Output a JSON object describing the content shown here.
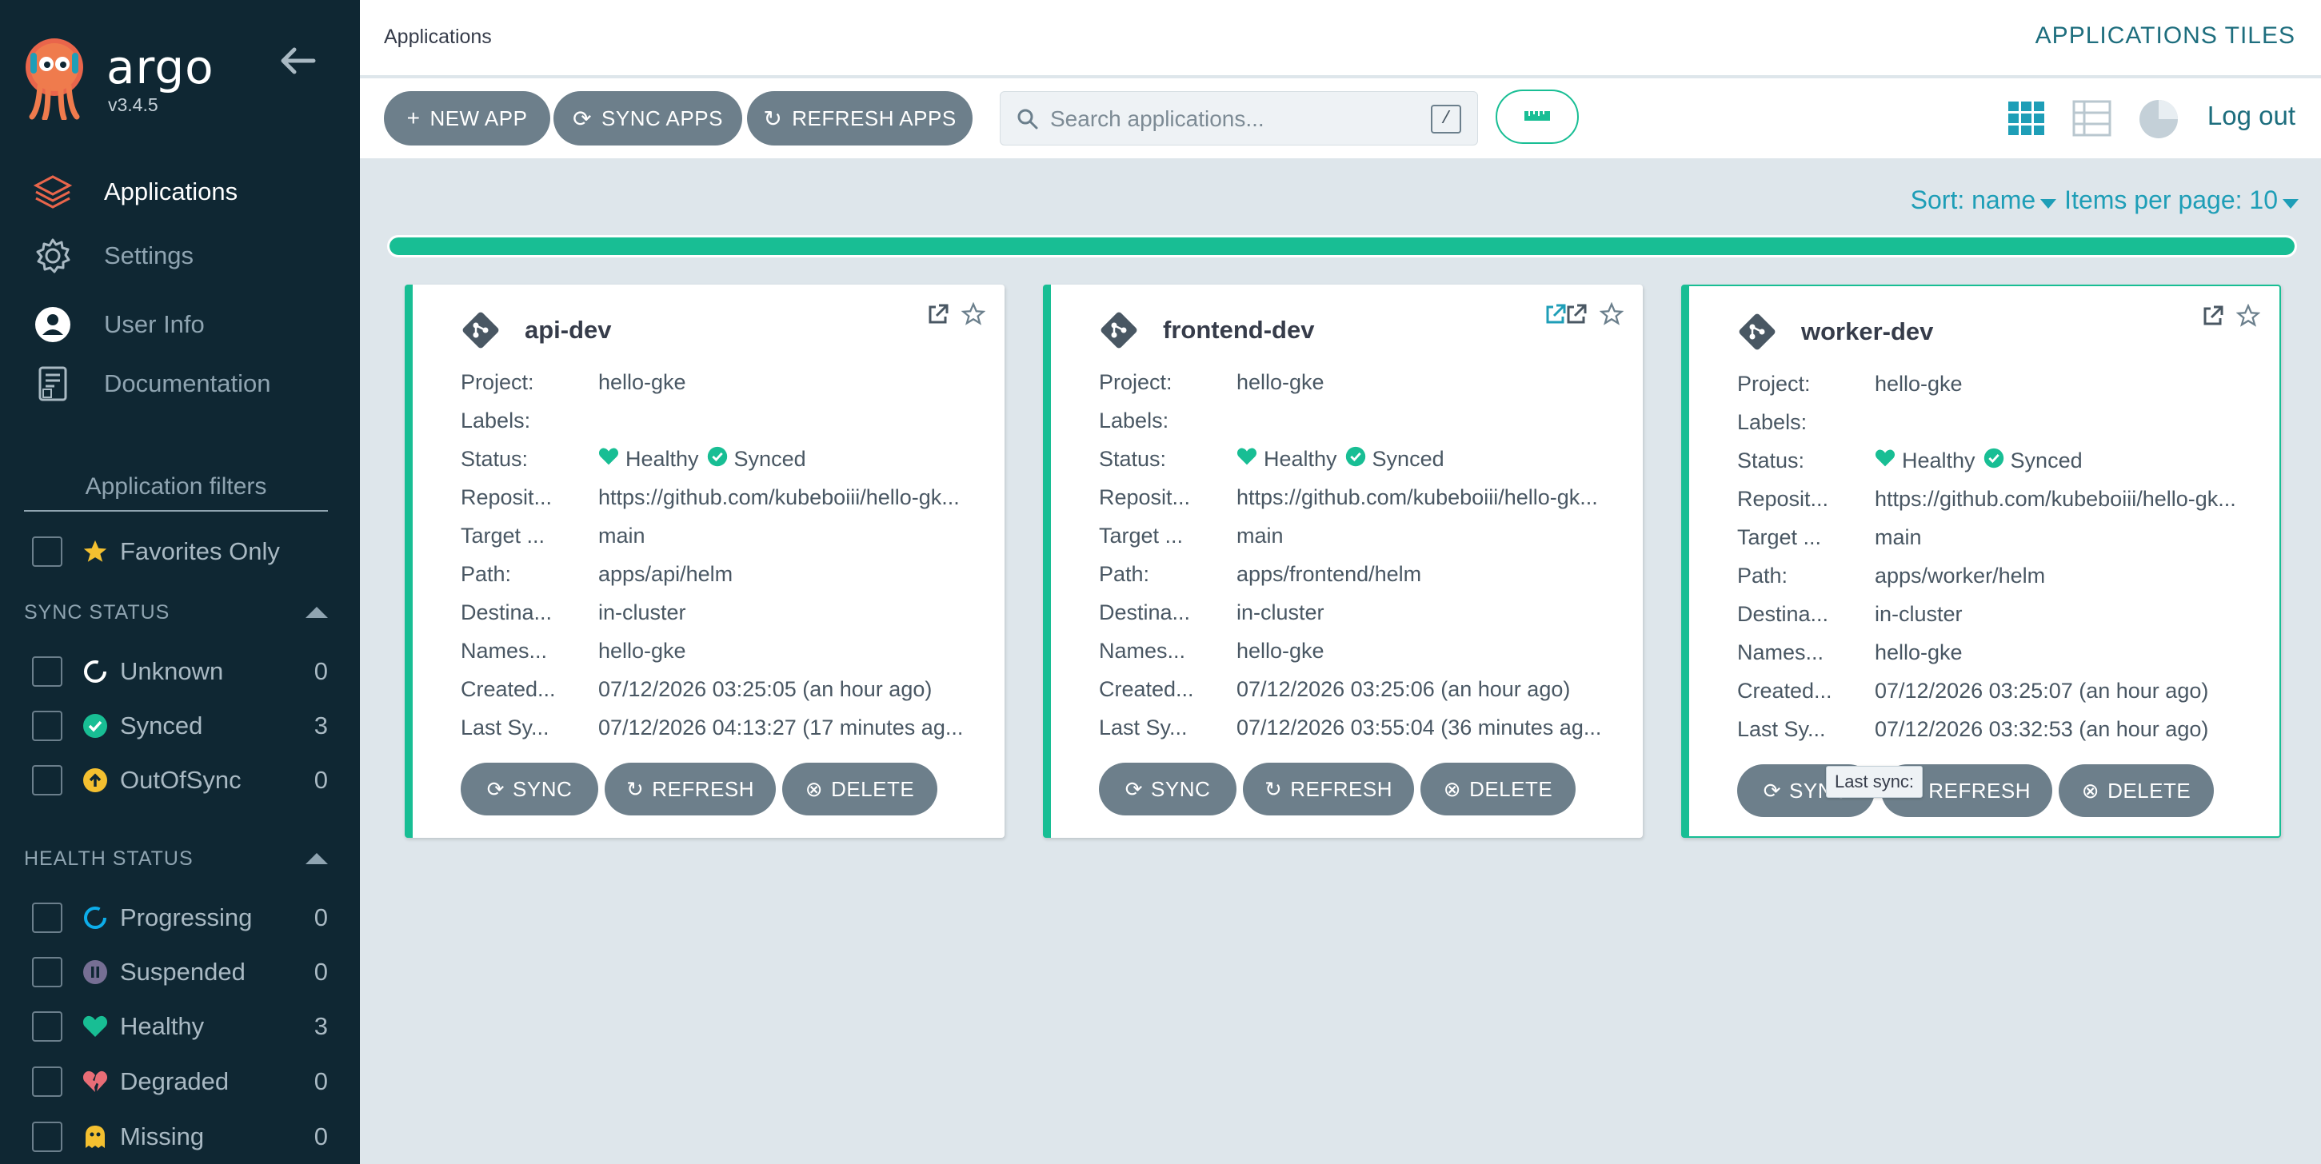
{
  "sidebar": {
    "brand": "argo",
    "version": "v3.4.5",
    "nav": [
      {
        "label": "Applications",
        "icon": "layers-icon",
        "active": true
      },
      {
        "label": "Settings",
        "icon": "gear-icon"
      },
      {
        "label": "User Info",
        "icon": "user-icon"
      },
      {
        "label": "Documentation",
        "icon": "docs-icon"
      }
    ],
    "filters_title": "Application filters",
    "favorites_label": "Favorites Only",
    "sync_status_title": "SYNC STATUS",
    "sync_status": [
      {
        "label": "Unknown",
        "count": "0"
      },
      {
        "label": "Synced",
        "count": "3"
      },
      {
        "label": "OutOfSync",
        "count": "0"
      }
    ],
    "health_status_title": "HEALTH STATUS",
    "health_status": [
      {
        "label": "Progressing",
        "count": "0"
      },
      {
        "label": "Suspended",
        "count": "0"
      },
      {
        "label": "Healthy",
        "count": "3"
      },
      {
        "label": "Degraded",
        "count": "0"
      },
      {
        "label": "Missing",
        "count": "0"
      }
    ]
  },
  "topbar": {
    "breadcrumb": "Applications",
    "view_title": "APPLICATIONS TILES"
  },
  "toolbar": {
    "new_app": "NEW APP",
    "sync_apps": "SYNC APPS",
    "refresh_apps": "REFRESH APPS",
    "search_placeholder": "Search applications...",
    "search_shortcut": "/",
    "logout": "Log out"
  },
  "sort": {
    "sort_label": "Sort: name",
    "items_label": "Items per page: 10"
  },
  "progress": {
    "fraction": 1.0
  },
  "colors": {
    "accent": "#18be94",
    "sidebar_bg": "#0f2733",
    "button_bg": "#6d7f8b",
    "link": "#1e9eb7"
  },
  "field_labels": {
    "project": "Project:",
    "labels": "Labels:",
    "status": "Status:",
    "repository": "Reposit...",
    "target": "Target ...",
    "path": "Path:",
    "destination": "Destina...",
    "namespace": "Names...",
    "created": "Created...",
    "last_sync": "Last Sy..."
  },
  "card_buttons": {
    "sync": "SYNC",
    "refresh": "REFRESH",
    "delete": "DELETE"
  },
  "apps": [
    {
      "name": "api-dev",
      "project": "hello-gke",
      "labels": "",
      "health": "Healthy",
      "sync": "Synced",
      "repository": "https://github.com/kubeboiii/hello-gk...",
      "target": "main",
      "path": "apps/api/helm",
      "destination": "in-cluster",
      "namespace": "hello-gke",
      "created": "07/12/2026 03:25:05  (an hour ago)",
      "last_sync": "07/12/2026 04:13:27  (17 minutes ag..."
    },
    {
      "name": "frontend-dev",
      "project": "hello-gke",
      "labels": "",
      "health": "Healthy",
      "sync": "Synced",
      "repository": "https://github.com/kubeboiii/hello-gk...",
      "target": "main",
      "path": "apps/frontend/helm",
      "destination": "in-cluster",
      "namespace": "hello-gke",
      "created": "07/12/2026 03:25:06  (an hour ago)",
      "last_sync": "07/12/2026 03:55:04  (36 minutes ag..."
    },
    {
      "name": "worker-dev",
      "project": "hello-gke",
      "labels": "",
      "health": "Healthy",
      "sync": "Synced",
      "repository": "https://github.com/kubeboiii/hello-gk...",
      "target": "main",
      "path": "apps/worker/helm",
      "destination": "in-cluster",
      "namespace": "hello-gke",
      "created": "07/12/2026 03:25:07  (an hour ago)",
      "last_sync": "07/12/2026 03:32:53  (an hour ago)"
    }
  ],
  "tooltip": "Last sync:"
}
